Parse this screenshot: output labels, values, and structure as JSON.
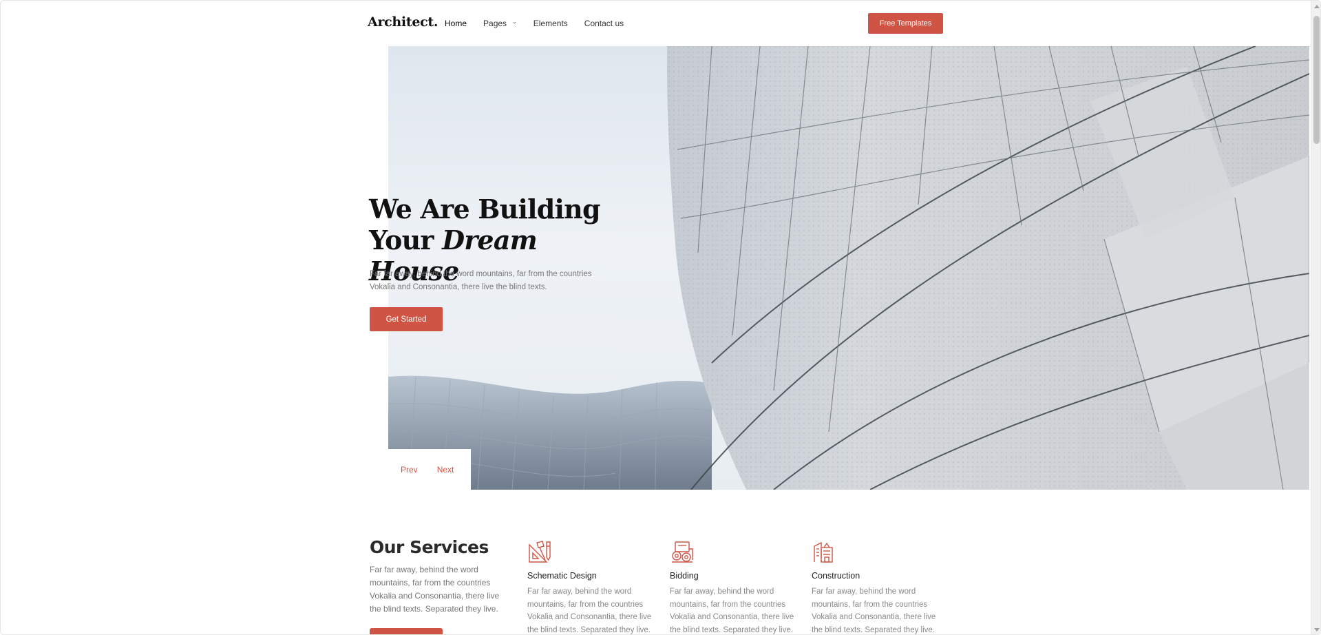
{
  "header": {
    "logo": "Architect.",
    "nav": [
      {
        "label": "Home"
      },
      {
        "label": "Pages"
      },
      {
        "label": "Elements"
      },
      {
        "label": "Contact us"
      }
    ],
    "cta_label": "Free Templates"
  },
  "hero": {
    "title_line1": "We Are Building",
    "title_line2_plain": "Your ",
    "title_line2_italic": "Dream House",
    "text": "Far far away, behind the word mountains, far from the countries Vokalia and Consonantia, there live the blind texts.",
    "button_label": "Get Started",
    "prev_label": "Prev",
    "next_label": "Next"
  },
  "services": {
    "title": "Our Services",
    "text": "Far far away, behind the word mountains, far from the countries Vokalia and Consonantia, there live the blind texts. Separated they live.",
    "items": [
      {
        "icon": "drafting-tools-icon",
        "title": "Schematic Design",
        "text": "Far far away, behind the word mountains, far from the countries Vokalia and Consonantia, there live the blind texts. Separated they live."
      },
      {
        "icon": "gears-blueprint-icon",
        "title": "Bidding",
        "text": "Far far away, behind the word mountains, far from the countries Vokalia and Consonantia, there live the blind texts. Separated they live."
      },
      {
        "icon": "buildings-icon",
        "title": "Construction",
        "text": "Far far away, behind the word mountains, far from the countries Vokalia and Consonantia, there live the blind texts. Separated they live."
      }
    ]
  },
  "colors": {
    "accent": "#cf5444",
    "heading": "#111111",
    "body_text": "#777777"
  }
}
